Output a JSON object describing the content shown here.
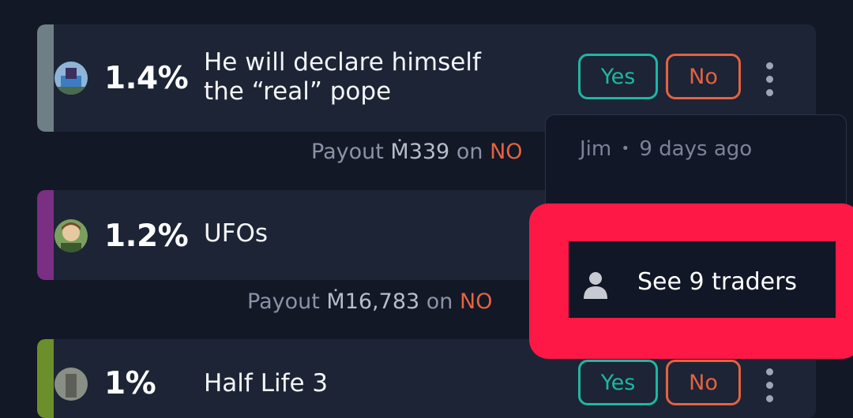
{
  "markets": [
    {
      "percent": "1.4%",
      "title_line1": "He will declare himself",
      "title_line2": "the “real” pope",
      "yes_label": "Yes",
      "no_label": "No",
      "bar_color": "#6e7f86",
      "payout_prefix": "Payout",
      "payout_amount": "Ṁ339",
      "payout_on": "on",
      "payout_side": "NO"
    },
    {
      "percent": "1.2%",
      "title_line1": "UFOs",
      "bar_color": "#7a2f83",
      "payout_prefix": "Payout",
      "payout_amount": "Ṁ16,783",
      "payout_on": "on",
      "payout_side": "NO"
    },
    {
      "percent": "1%",
      "title_line1": "Half Life 3",
      "yes_label": "Yes",
      "no_label": "No",
      "bar_color": "#6b8f2a"
    }
  ],
  "dropdown": {
    "author": "Jim",
    "separator": "•",
    "time": "9 days ago",
    "see_traders_label": "See 9 traders"
  },
  "colors": {
    "yes": "#1fb6a3",
    "no": "#e5623f",
    "highlight": "#fd1845"
  },
  "icons": [
    "avatar",
    "kebab-menu-icon",
    "person-icon"
  ]
}
